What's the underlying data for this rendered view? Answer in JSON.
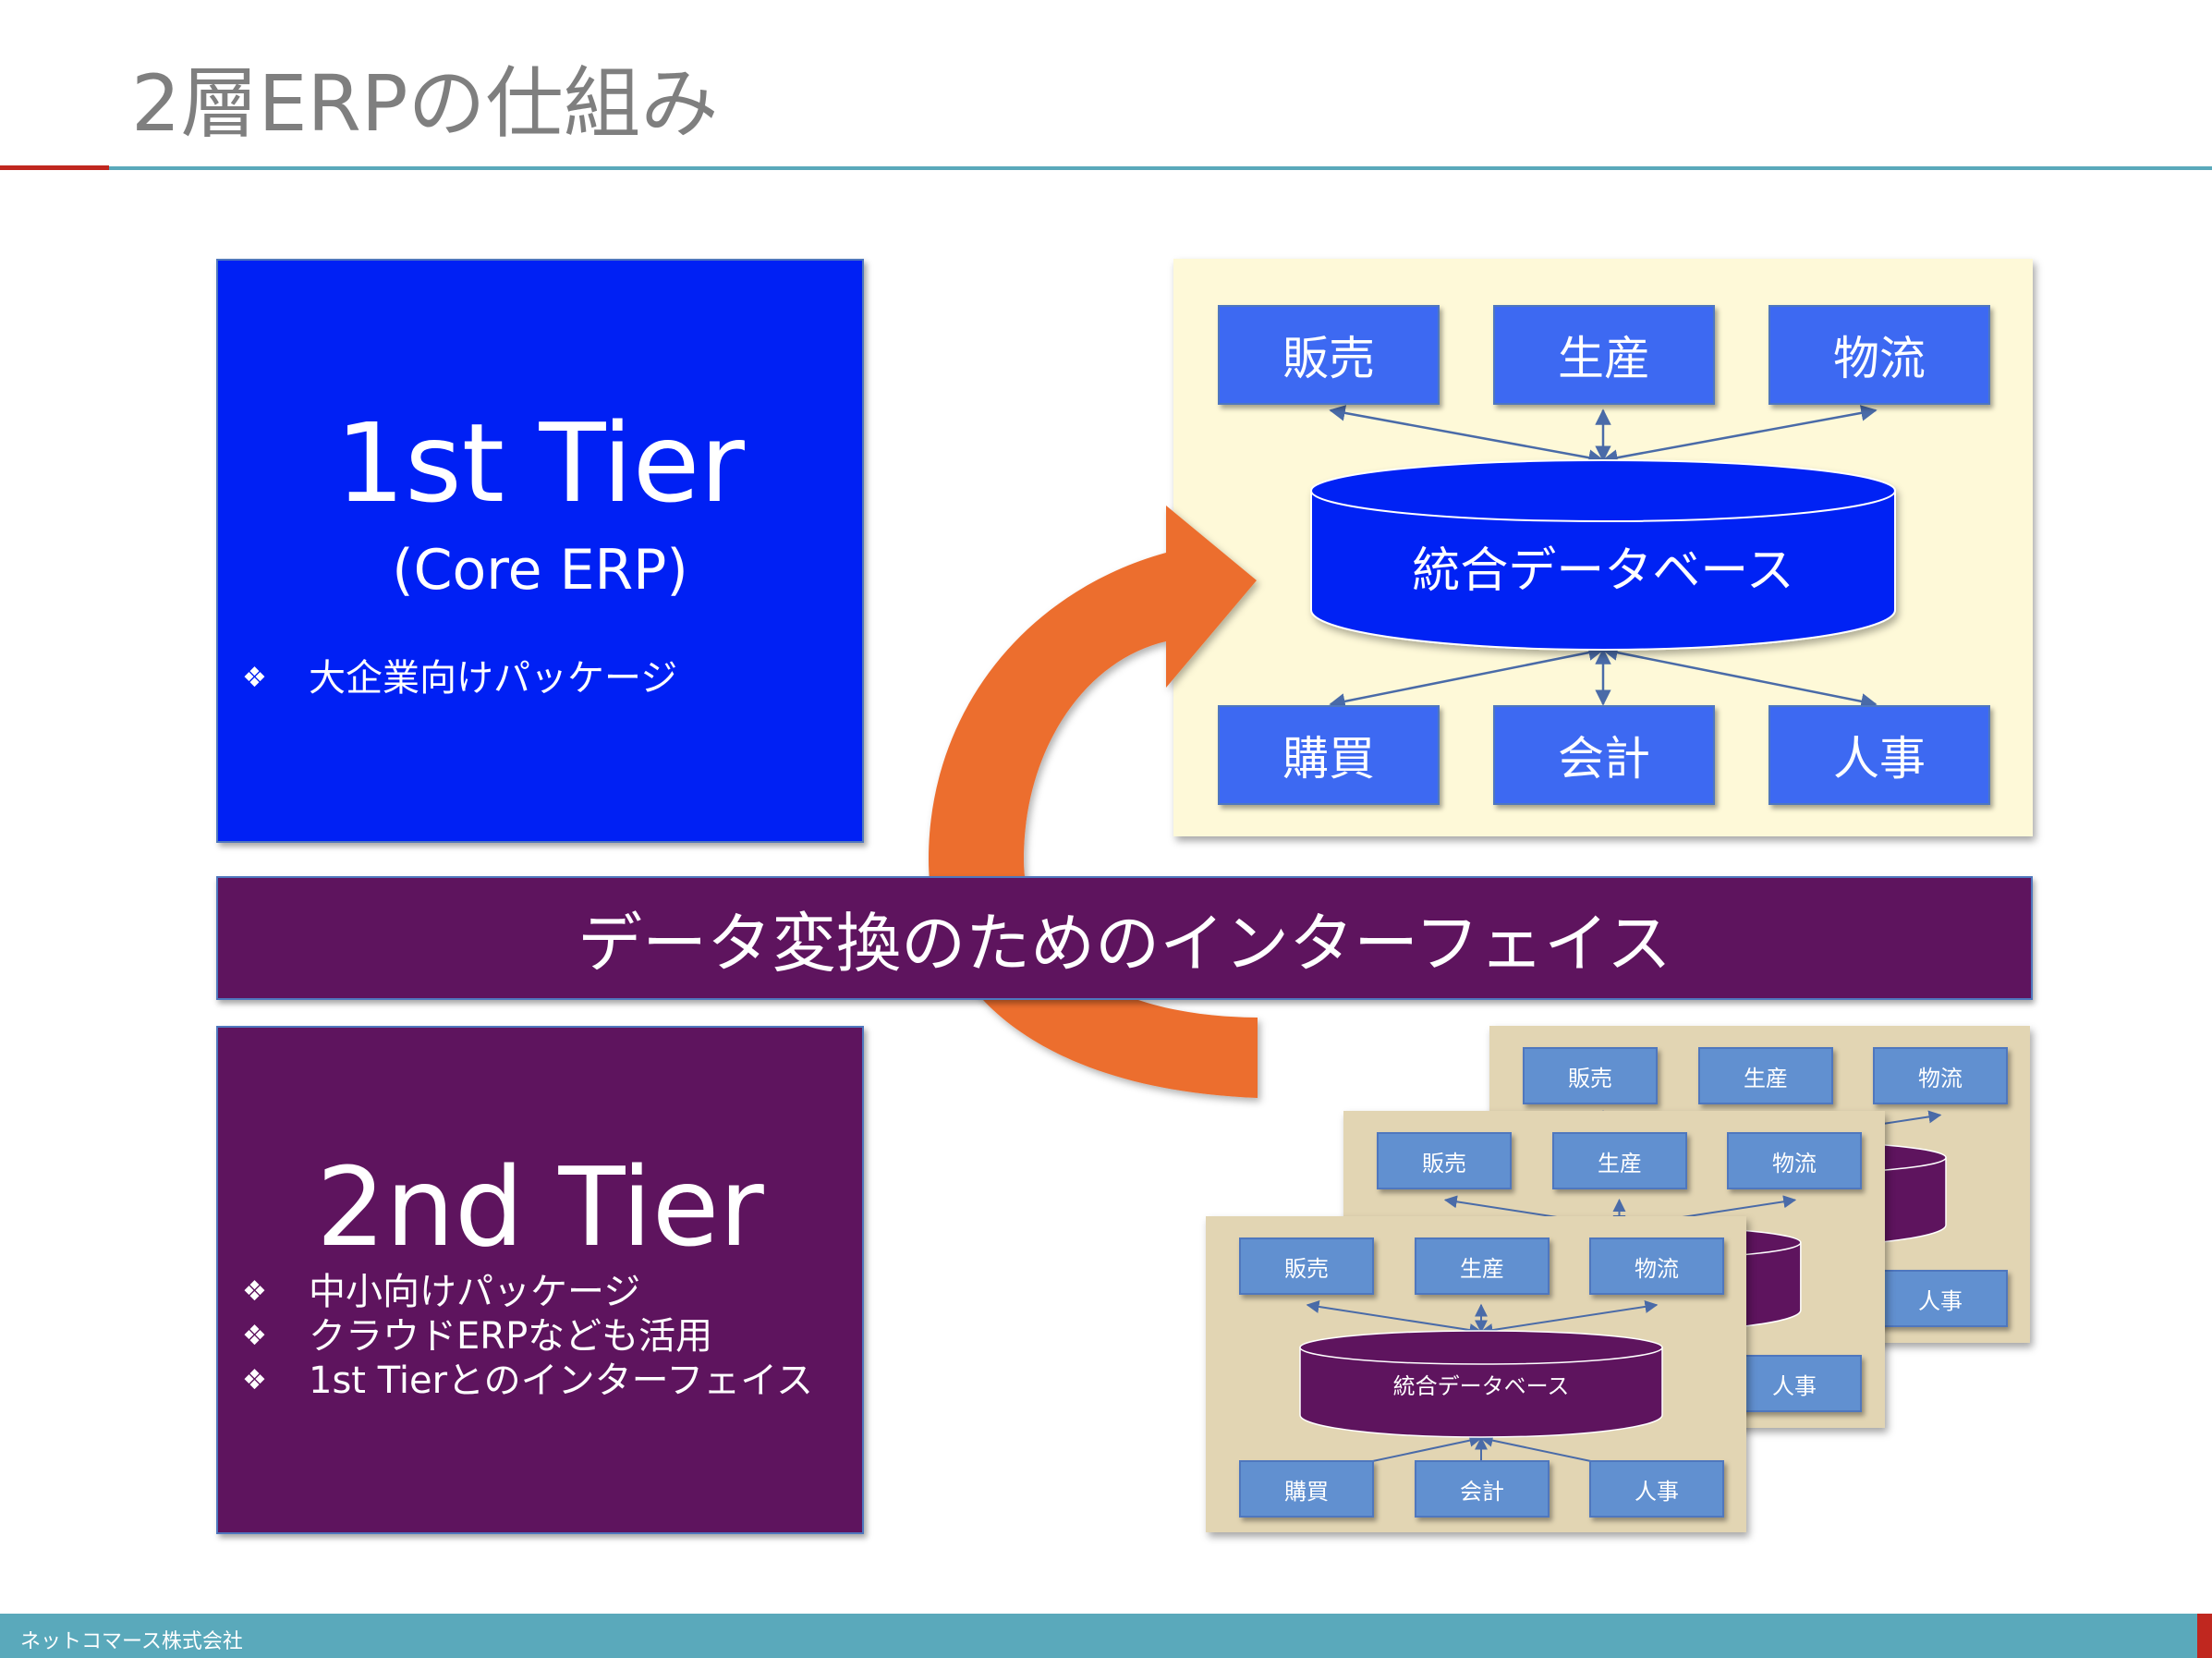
{
  "title": "2層ERPの仕組み",
  "colors": {
    "title_gray": "#7f7f7f",
    "accent_red": "#C0271F",
    "accent_teal": "#5AA9BB",
    "tier1_blue": "#0020F4",
    "tier2_purple": "#5E145E",
    "arrow_orange": "#EC6E2F",
    "core_panel_bg": "#FEF9D8",
    "core_module_blue": "#3D69F2",
    "tier2_panel_bg": "#E2D5B3",
    "tier2_module_blue": "#6190D0",
    "connector": "#4A6BA8"
  },
  "tier1": {
    "title": "1st Tier",
    "subtitle": "(Core ERP)",
    "bullet_icon": "diamond-cluster-icon",
    "bullet_glyph": "❖",
    "bullets": [
      "大企業向けパッケージ"
    ]
  },
  "tier2": {
    "title": "2nd Tier",
    "bullet_icon": "diamond-cluster-icon",
    "bullet_glyph": "❖",
    "bullets": [
      "中小向けパッケージ",
      "クラウドERPなども活用",
      "1st Tierとのインターフェイス"
    ]
  },
  "interface_bar": {
    "label": "データ変換のためのインターフェイス"
  },
  "arrow": {
    "icon": "curved-arrow-icon",
    "direction": "from 2nd Tier systems to 1st Tier core"
  },
  "core_diagram": {
    "database": "統合データベース",
    "top_modules": [
      "販売",
      "生産",
      "物流"
    ],
    "bottom_modules": [
      "購買",
      "会計",
      "人事"
    ]
  },
  "tier2_diagrams": {
    "count": 3,
    "database": "統合データベース",
    "top_modules": [
      "販売",
      "生産",
      "物流"
    ],
    "bottom_modules": [
      "購買",
      "会計",
      "人事"
    ]
  },
  "footer": {
    "company": "ネットコマース株式会社"
  }
}
